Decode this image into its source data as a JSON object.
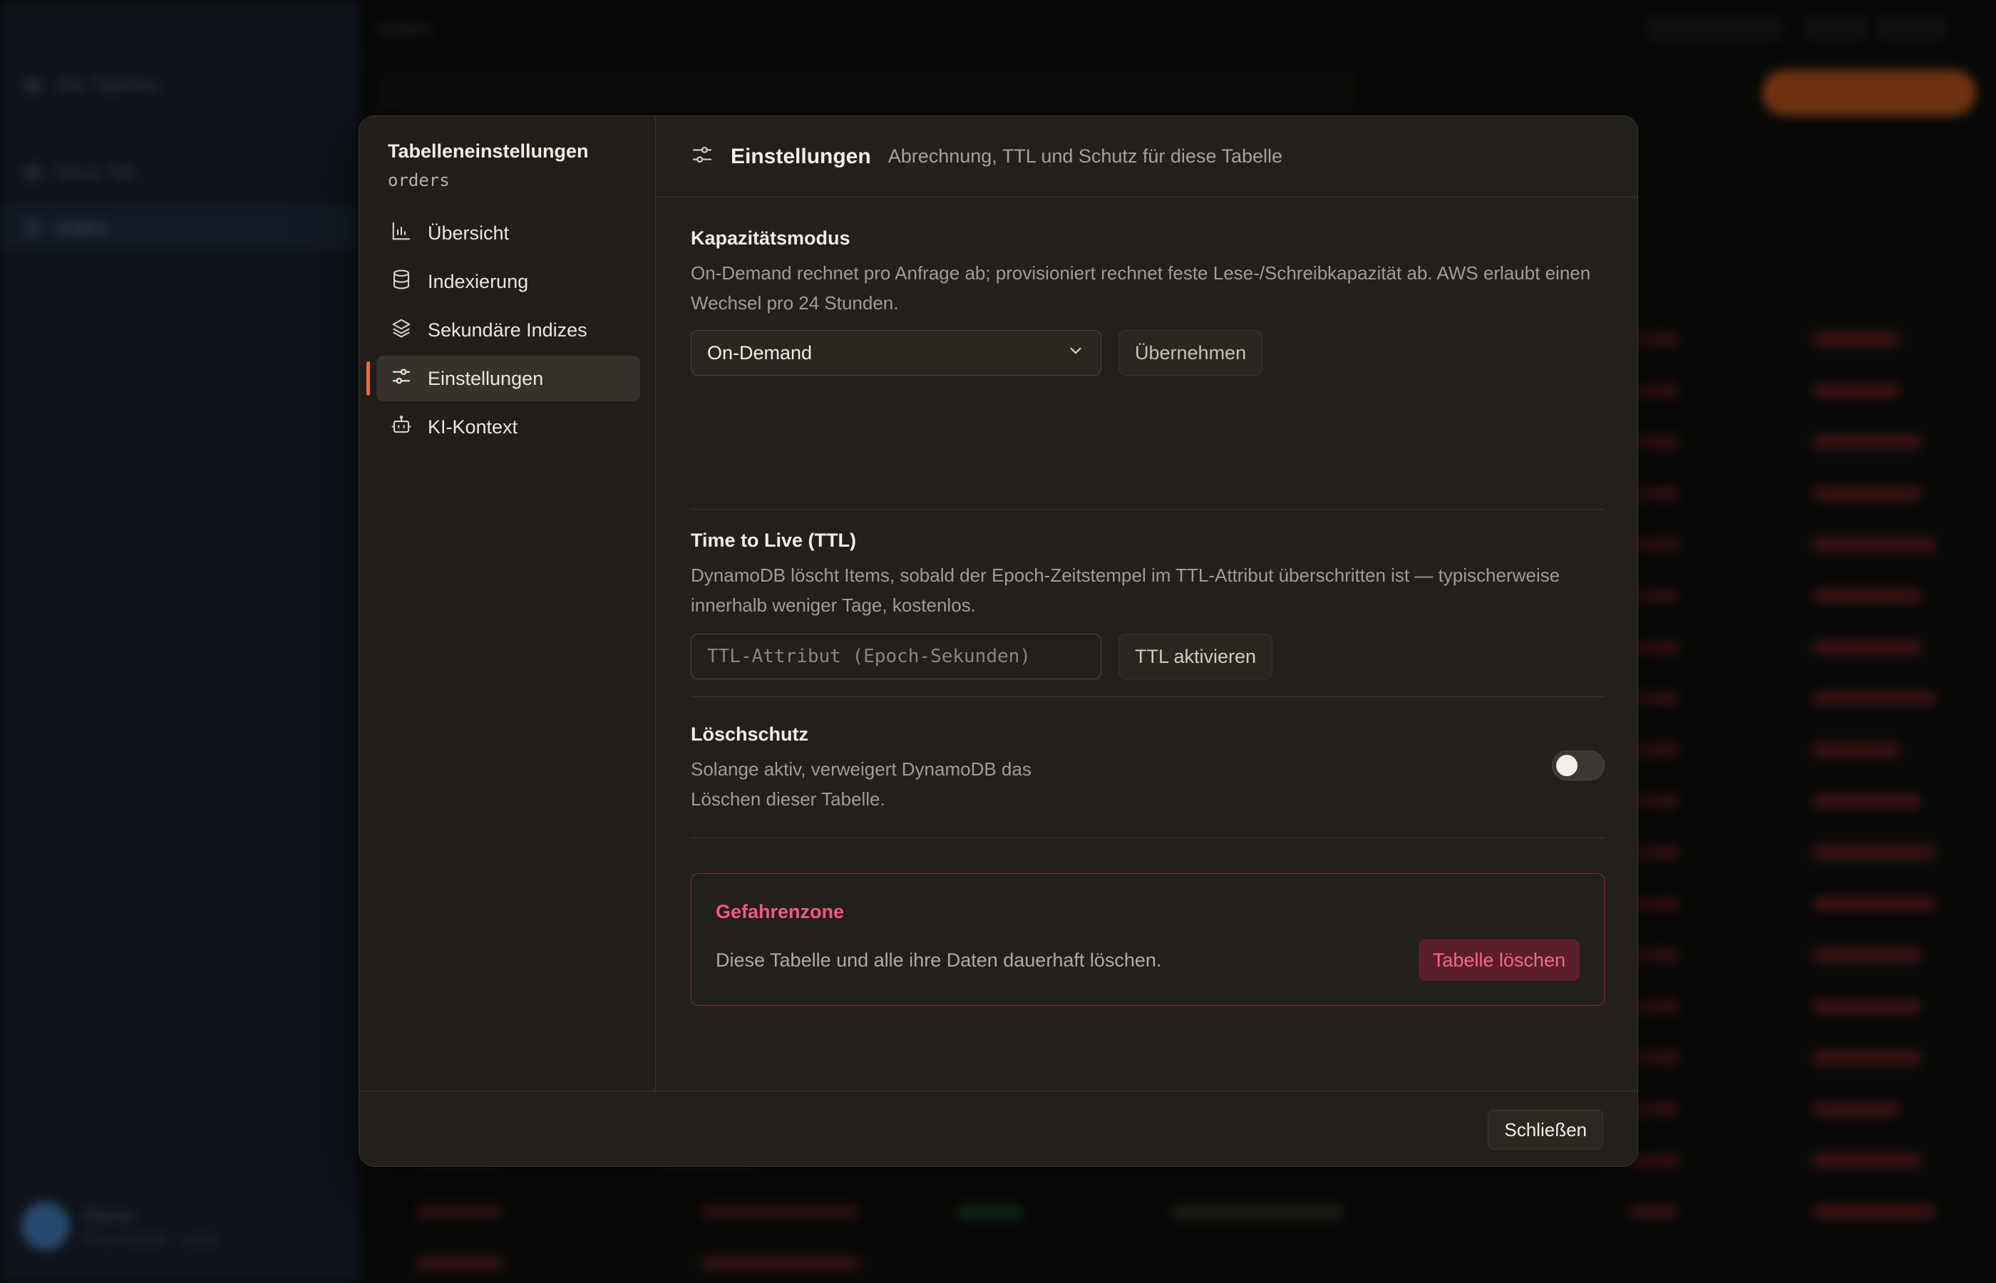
{
  "background": {
    "sidebar": {
      "back_label": "Alle Tabellen",
      "new_table": "Neue Tab",
      "active_table": "orders",
      "user_name": "Demo",
      "user_sub": "Free Modell · Lokal"
    },
    "topbar_title": "orders"
  },
  "modal": {
    "nav_title": "Tabelleneinstellungen",
    "nav_subtitle": "orders",
    "nav_items": [
      {
        "label": "Übersicht",
        "icon": "bar-chart-icon"
      },
      {
        "label": "Indexierung",
        "icon": "database-icon"
      },
      {
        "label": "Sekundäre Indizes",
        "icon": "layers-icon"
      },
      {
        "label": "Einstellungen",
        "icon": "sliders-icon",
        "active": true
      },
      {
        "label": "KI-Kontext",
        "icon": "robot-icon"
      }
    ],
    "header": {
      "title": "Einstellungen",
      "description": "Abrechnung, TTL und Schutz für diese Tabelle"
    },
    "capacity": {
      "title": "Kapazitätsmodus",
      "description": "On-Demand rechnet pro Anfrage ab; provisioniert rechnet feste Lese-/Schreibkapazität ab. AWS erlaubt einen Wechsel pro 24 Stunden.",
      "selected": "On-Demand",
      "apply_label": "Übernehmen"
    },
    "ttl": {
      "title": "Time to Live (TTL)",
      "description": "DynamoDB löscht Items, sobald der Epoch-Zeitstempel im TTL-Attribut überschritten ist — typischerweise innerhalb weniger Tage, kostenlos.",
      "placeholder": "TTL-Attribut (Epoch-Sekunden)",
      "button_label": "TTL aktivieren"
    },
    "deletion_protection": {
      "title": "Löschschutz",
      "description": "Solange aktiv, verweigert DynamoDB das Löschen dieser Tabelle.",
      "enabled": false
    },
    "danger_zone": {
      "title": "Gefahrenzone",
      "description": "Diese Tabelle und alle ihre Daten dauerhaft löschen.",
      "button_label": "Tabelle löschen"
    },
    "close_label": "Schließen"
  },
  "colors": {
    "accent": "#ee6a2e",
    "danger": "#f05a7c"
  }
}
